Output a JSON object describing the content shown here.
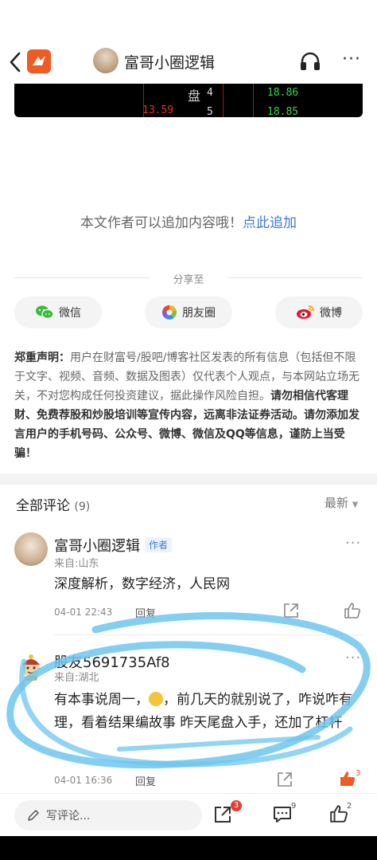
{
  "header": {
    "title": "富哥小圈逻辑"
  },
  "stock_panel": {
    "label_char": "盘",
    "rows": [
      {
        "level": "4",
        "price": "18.86"
      },
      {
        "level": "5",
        "price": "18.85"
      }
    ],
    "left_value": "13.59"
  },
  "article": {
    "add_prefix": "本文作者可以追加内容哦！",
    "add_link": "点此追加"
  },
  "share": {
    "label": "分享至",
    "buttons": [
      "微信",
      "朋友圈",
      "微博"
    ]
  },
  "disclaimer": {
    "title": "郑重声明：",
    "normal": "用户在财富号/股吧/博客社区发表的所有信息（包括但不限于文字、视频、音频、数据及图表）仅代表个人观点，与本网站立场无关，不对您构成任何投资建议，据此操作风险自担。",
    "bold": "请勿相信代客理财、免费荐股和炒股培训等宣传内容，远离非法证券活动。请勿添加发言用户的手机号码、公众号、微博、微信及QQ等信息，谨防上当受骗！"
  },
  "comments": {
    "title": "全部评论",
    "count": "(9)",
    "sort_label": "最新",
    "items": [
      {
        "name": "富哥小圈逻辑",
        "tag": "作者",
        "from": "来自:山东",
        "text": "深度解析，数字经济，人民网",
        "time": "04-01 22:43",
        "reply": "回复"
      },
      {
        "name": "股友5691735Af8",
        "from": "来自:湖北",
        "text_before_emoji": "有本事说周一，",
        "text_after_emoji": "，前几天的就别说了，咋说咋有理，看着结果编故事 昨天尾盘入手，还加了杠杆",
        "time": "04-01 16:36",
        "reply": "回复",
        "likes": "3"
      }
    ]
  },
  "bottom_bar": {
    "input_placeholder": "写评论...",
    "share_badge": "3",
    "comment_count": "9",
    "like_count": "2"
  },
  "colors": {
    "accent": "#3a7bd5",
    "brand": "#f05a23",
    "badge": "#e63c2f",
    "scribble": "#6ec6f0"
  }
}
